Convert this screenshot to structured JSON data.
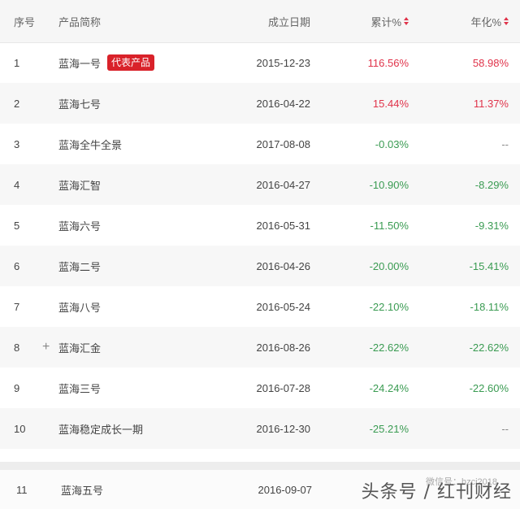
{
  "table": {
    "headers": {
      "index": "序号",
      "name": "产品简称",
      "date": "成立日期",
      "cumulative": "累计%",
      "annualized": "年化%"
    },
    "rows": [
      {
        "index": "1",
        "name": "蓝海一号",
        "badge": "代表产品",
        "date": "2015-12-23",
        "cumulative": "116.56%",
        "annualized": "58.98%"
      },
      {
        "index": "2",
        "name": "蓝海七号",
        "date": "2016-04-22",
        "cumulative": "15.44%",
        "annualized": "11.37%"
      },
      {
        "index": "3",
        "name": "蓝海全牛全景",
        "date": "2017-08-08",
        "cumulative": "-0.03%",
        "annualized": "--"
      },
      {
        "index": "4",
        "name": "蓝海汇智",
        "date": "2016-04-27",
        "cumulative": "-10.90%",
        "annualized": "-8.29%"
      },
      {
        "index": "5",
        "name": "蓝海六号",
        "date": "2016-05-31",
        "cumulative": "-11.50%",
        "annualized": "-9.31%"
      },
      {
        "index": "6",
        "name": "蓝海二号",
        "date": "2016-04-26",
        "cumulative": "-20.00%",
        "annualized": "-15.41%"
      },
      {
        "index": "7",
        "name": "蓝海八号",
        "date": "2016-05-24",
        "cumulative": "-22.10%",
        "annualized": "-18.11%"
      },
      {
        "index": "8",
        "name": "蓝海汇金",
        "expand": "+",
        "date": "2016-08-26",
        "cumulative": "-22.62%",
        "annualized": "-22.62%"
      },
      {
        "index": "9",
        "name": "蓝海三号",
        "date": "2016-07-28",
        "cumulative": "-24.24%",
        "annualized": "-22.60%"
      },
      {
        "index": "10",
        "name": "蓝海稳定成长一期",
        "date": "2016-12-30",
        "cumulative": "-25.21%",
        "annualized": "--"
      }
    ],
    "row11": {
      "index": "11",
      "name": "蓝海五号",
      "date": "2016-09-07"
    }
  },
  "watermark": {
    "small": "微信号：hzcj2018",
    "large": "头条号 / 红刊财经"
  },
  "colors": {
    "positive": "#e0334a",
    "negative": "#3a9b52",
    "badge": "#d9222a"
  }
}
